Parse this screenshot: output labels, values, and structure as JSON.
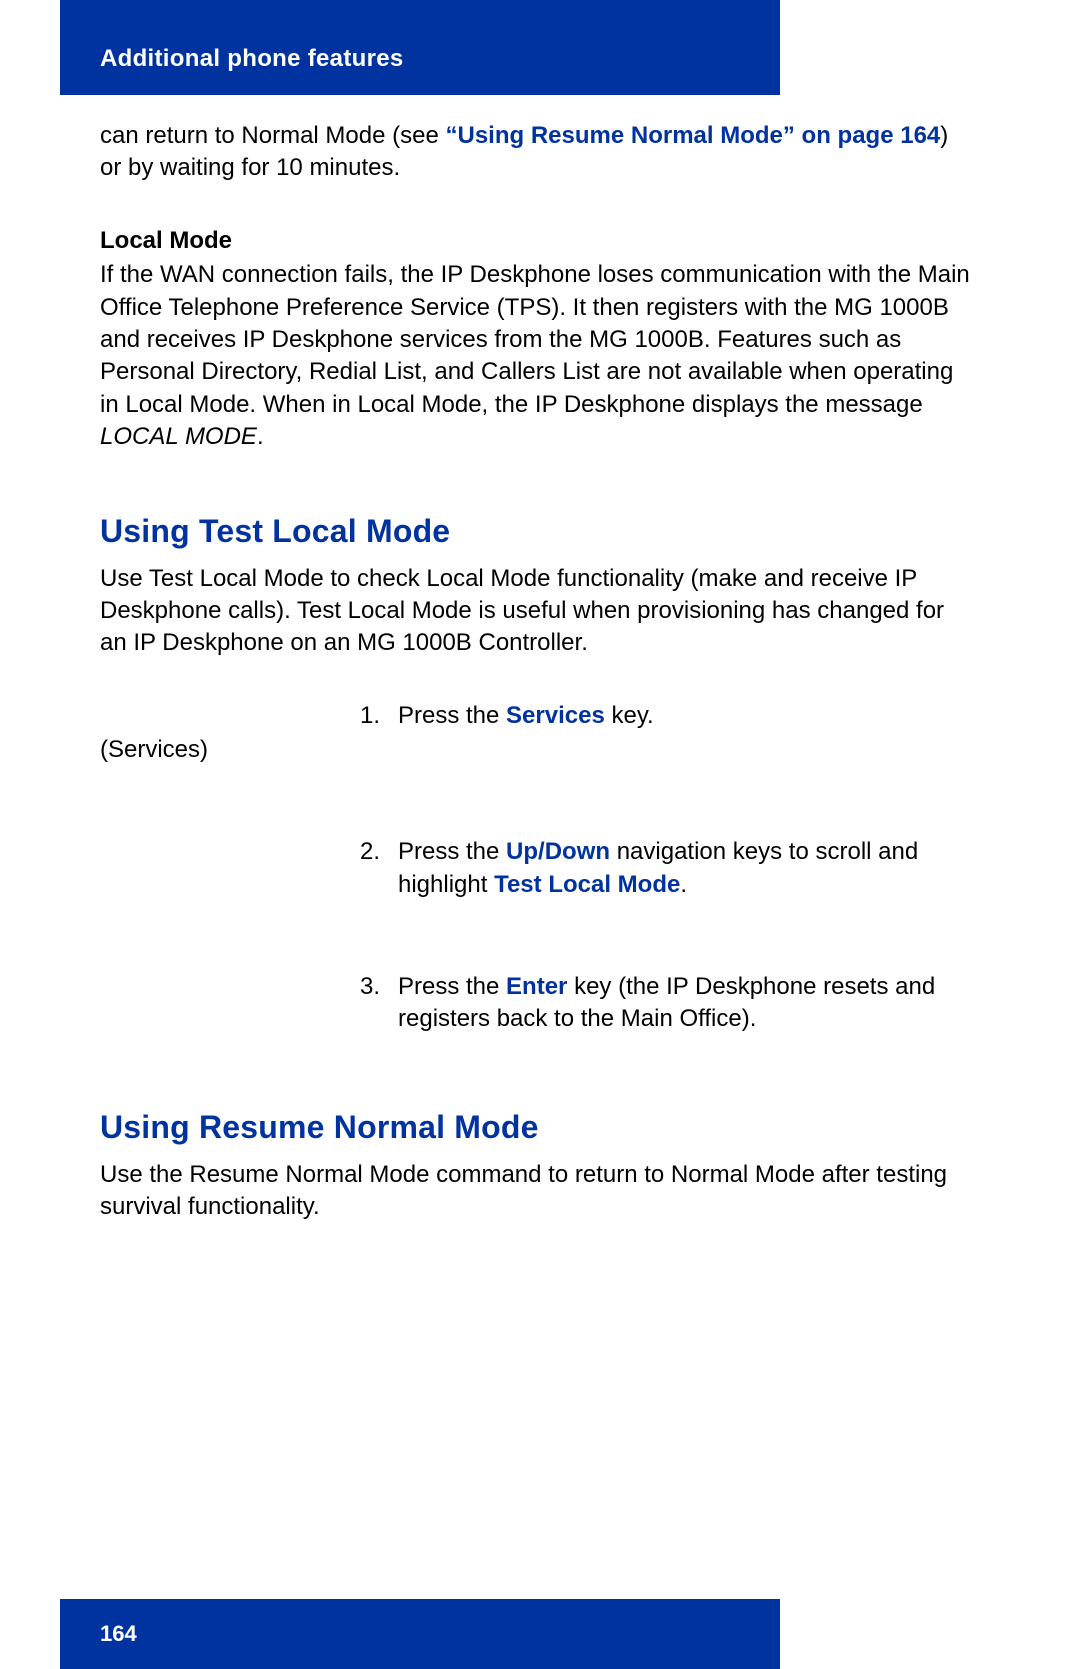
{
  "header": {
    "title": "Additional phone features"
  },
  "intro": {
    "prefix": "can return to Normal Mode (see ",
    "xref": "“Using Resume Normal Mode” on page 164",
    "suffix": ") or by waiting for 10 minutes."
  },
  "local_mode": {
    "heading": "Local Mode",
    "body_pre": "If the WAN connection fails, the IP Deskphone loses communication with the Main Office Telephone Preference Service (TPS). It then registers with the MG 1000B and receives IP Deskphone services from the MG 1000B. Features such as Personal Directory, Redial List, and Callers List are not available when operating in Local Mode. When in Local Mode, the IP Deskphone displays the message ",
    "body_italic": "LOCAL MODE",
    "body_post": "."
  },
  "test_local": {
    "heading": "Using Test Local Mode",
    "intro": "Use Test Local Mode to check Local Mode functionality (make and receive IP Deskphone calls). Test Local Mode is useful when provisioning has changed for an IP Deskphone on an MG 1000B Controller.",
    "gutter_label": "(Services)",
    "steps": [
      {
        "num": "1.",
        "parts": [
          {
            "t": "Press the ",
            "style": "plain"
          },
          {
            "t": "Services",
            "style": "xref"
          },
          {
            "t": " key.",
            "style": "plain"
          }
        ]
      },
      {
        "num": "2.",
        "parts": [
          {
            "t": "Press the ",
            "style": "plain"
          },
          {
            "t": "Up/Down",
            "style": "xref"
          },
          {
            "t": " navigation keys to scroll and highlight ",
            "style": "plain"
          },
          {
            "t": "Test Local Mode",
            "style": "xref"
          },
          {
            "t": ".",
            "style": "plain"
          }
        ]
      },
      {
        "num": "3.",
        "parts": [
          {
            "t": "Press the ",
            "style": "plain"
          },
          {
            "t": "Enter",
            "style": "xref"
          },
          {
            "t": " key (the IP Deskphone resets and registers back to the Main Office).",
            "style": "plain"
          }
        ]
      }
    ]
  },
  "resume_normal": {
    "heading": "Using Resume Normal Mode",
    "intro": "Use the Resume Normal Mode command to return to Normal Mode after testing survival functionality."
  },
  "footer": {
    "page_number": "164"
  }
}
